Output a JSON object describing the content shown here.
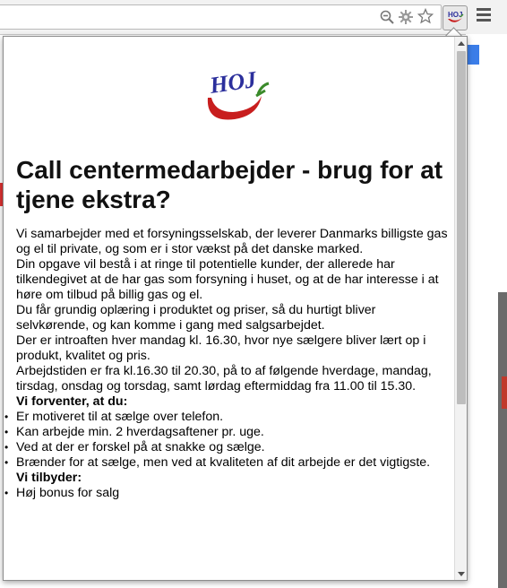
{
  "popup": {
    "logo_text": "HOJ",
    "title": "Call centermedarbejder - brug for at tjene ekstra?",
    "paragraphs": [
      "Vi samarbejder med et forsyningsselskab, der leverer Danmarks billigste gas og el til private, og som er i stor vækst på det danske marked.",
      "Din opgave vil bestå i at ringe til potentielle kunder, der allerede har tilkendegivet at de har gas som forsyning i huset, og at de har interesse i at høre om tilbud på billig gas og el.",
      "Du får grundig oplæring i produktet og priser, så du hurtigt bliver selvkørende, og kan komme i gang med salgsarbejdet.",
      "Der er introaften hver mandag kl. 16.30, hvor nye sælgere bliver lært op i produkt, kvalitet og pris.",
      "Arbejdstiden er fra kl.16.30 til 20.30, på to af følgende hverdage, mandag, tirsdag, onsdag og torsdag, samt lørdag eftermiddag fra 11.00 til 15.30."
    ],
    "expect_heading": "Vi forventer, at du:",
    "expect_items": [
      "Er motiveret til at sælge over telefon.",
      "Kan arbejde min. 2 hverdagsaftener pr. uge.",
      "Ved at der er forskel på at snakke og sælge.",
      "Brænder for at sælge, men ved at kvaliteten af dit arbejde er det vigtigste."
    ],
    "offer_heading": "Vi tilbyder:",
    "offer_items": [
      "Høj bonus for salg"
    ]
  },
  "icons": {
    "zoom": "magnifier-minus-icon",
    "extension_puzzle": "puzzle-gear-icon",
    "bookmark": "star-icon",
    "extension_button": "hoj-extension-icon",
    "menu": "hamburger-menu-icon"
  },
  "colors": {
    "logo_blue": "#2b2f9c",
    "logo_red": "#c81e1e",
    "logo_green": "#3a8a2a",
    "page_blue_button": "#3b7de8"
  },
  "scroll": {
    "position_fraction": 0.0
  }
}
